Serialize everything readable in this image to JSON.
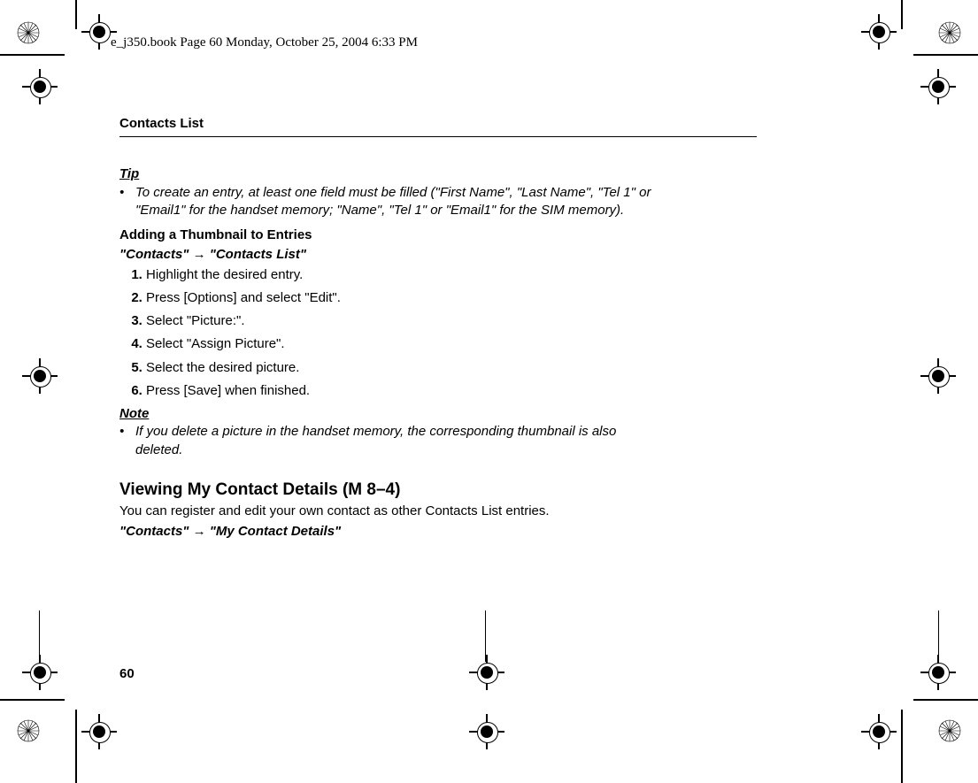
{
  "header": "e_j350.book  Page 60  Monday, October 25, 2004  6:33 PM",
  "section": "Contacts List",
  "tip": {
    "label": "Tip",
    "text": "To create an entry, at least one field must be filled (\"First Name\", \"Last Name\", \"Tel 1\" or \"Email1\" for the handset memory; \"Name\", \"Tel 1\" or \"Email1\" for the SIM memory)."
  },
  "thumb": {
    "heading": "Adding a Thumbnail to Entries",
    "nav": "\"Contacts\" → \"Contacts List\"",
    "steps": [
      "Highlight the desired entry.",
      "Press [Options] and select \"Edit\".",
      "Select \"Picture:\".",
      "Select \"Assign Picture\".",
      "Select the desired picture.",
      "Press [Save] when finished."
    ]
  },
  "note": {
    "label": "Note",
    "text": "If you delete a picture in the handset memory, the corresponding thumbnail is also deleted."
  },
  "viewing": {
    "heading": "Viewing My Contact Details (M 8–4)",
    "desc": "You can register and edit your own contact as other Contacts List entries.",
    "nav": "\"Contacts\" → \"My Contact Details\""
  },
  "pageNumber": "60"
}
